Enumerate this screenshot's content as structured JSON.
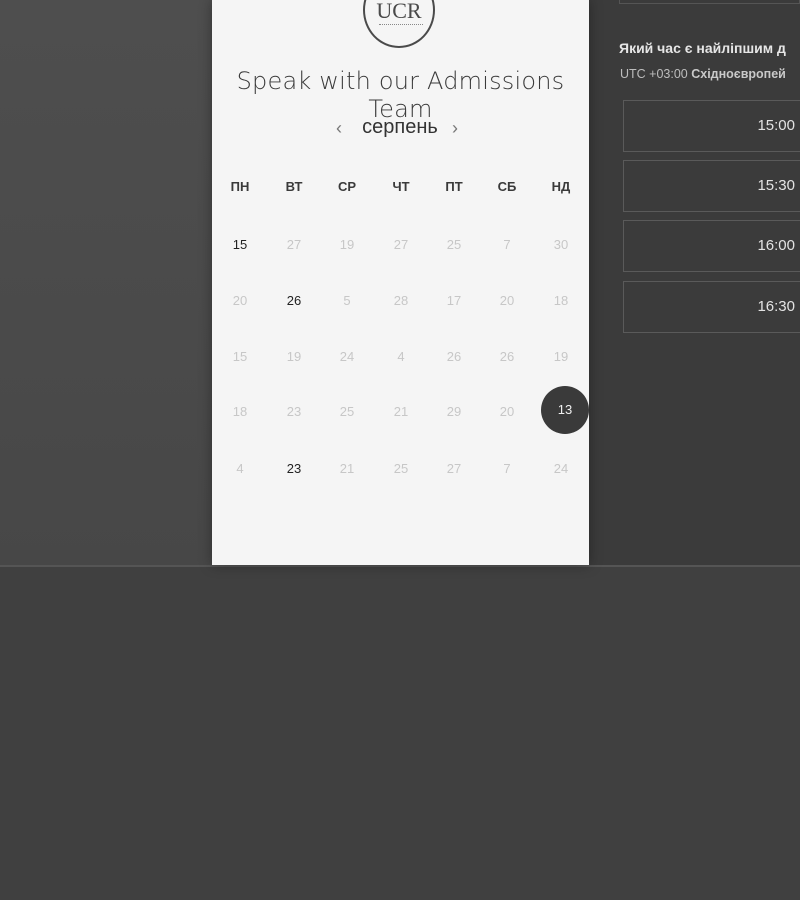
{
  "card": {
    "logo_text": "UCR",
    "title": "Speak with our Admissions Team"
  },
  "calendar": {
    "prev_arrow": "‹",
    "next_arrow": "›",
    "month": "серпень",
    "weekdays": [
      "ПН",
      "ВТ",
      "СР",
      "ЧТ",
      "ПТ",
      "СБ",
      "НД"
    ],
    "weeks": [
      [
        {
          "d": "15",
          "s": "active"
        },
        {
          "d": "27",
          "s": "disabled"
        },
        {
          "d": "19",
          "s": "disabled"
        },
        {
          "d": "27",
          "s": "disabled"
        },
        {
          "d": "25",
          "s": "disabled"
        },
        {
          "d": "7",
          "s": "disabled"
        },
        {
          "d": "30",
          "s": "disabled"
        }
      ],
      [
        {
          "d": "20",
          "s": "disabled"
        },
        {
          "d": "26",
          "s": "active"
        },
        {
          "d": "5",
          "s": "disabled"
        },
        {
          "d": "28",
          "s": "disabled"
        },
        {
          "d": "17",
          "s": "disabled"
        },
        {
          "d": "20",
          "s": "disabled"
        },
        {
          "d": "18",
          "s": "disabled"
        }
      ],
      [
        {
          "d": "15",
          "s": "disabled"
        },
        {
          "d": "19",
          "s": "disabled"
        },
        {
          "d": "24",
          "s": "disabled"
        },
        {
          "d": "4",
          "s": "disabled"
        },
        {
          "d": "26",
          "s": "disabled"
        },
        {
          "d": "26",
          "s": "disabled"
        },
        {
          "d": "19",
          "s": "disabled"
        }
      ],
      [
        {
          "d": "18",
          "s": "disabled"
        },
        {
          "d": "23",
          "s": "disabled"
        },
        {
          "d": "25",
          "s": "disabled"
        },
        {
          "d": "21",
          "s": "disabled"
        },
        {
          "d": "29",
          "s": "disabled"
        },
        {
          "d": "20",
          "s": "disabled"
        },
        {
          "d": "13",
          "s": "selected"
        }
      ],
      [
        {
          "d": "4",
          "s": "disabled"
        },
        {
          "d": "23",
          "s": "active"
        },
        {
          "d": "21",
          "s": "disabled"
        },
        {
          "d": "25",
          "s": "disabled"
        },
        {
          "d": "27",
          "s": "disabled"
        },
        {
          "d": "7",
          "s": "disabled"
        },
        {
          "d": "24",
          "s": "disabled"
        }
      ]
    ]
  },
  "time_panel": {
    "question": "Який час є найліпшим д",
    "tz_offset": "UTC +03:00",
    "tz_name": "Східноєвропей",
    "slots": [
      "15:00",
      "15:30",
      "16:00",
      "16:30"
    ]
  },
  "colors": {
    "selected_day": "#3a3a3a",
    "card_bg": "#f5f5f5",
    "page_bg": "#404040"
  }
}
